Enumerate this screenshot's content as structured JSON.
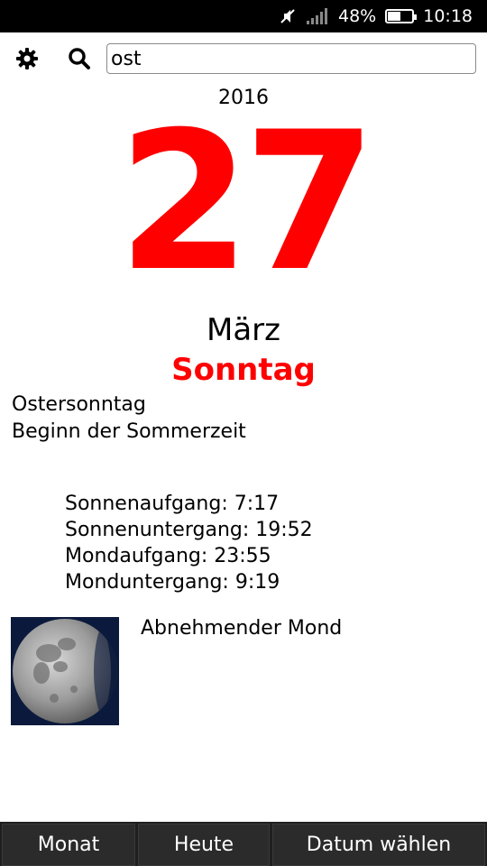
{
  "status_bar": {
    "battery_percent": "48%",
    "battery_level": 0.48,
    "time": "10:18",
    "icons": [
      "mute-icon",
      "signal-icon",
      "battery-icon"
    ]
  },
  "toolbar": {
    "settings_icon": "gear-icon",
    "search_icon": "search-icon",
    "search_value": "ost"
  },
  "date": {
    "year": "2016",
    "day": "27",
    "month": "März",
    "weekday": "Sonntag"
  },
  "holidays": [
    "Ostersonntag",
    "Beginn der Sommerzeit"
  ],
  "sun_moon": [
    "Sonnenaufgang: 7:17",
    "Sonnenuntergang: 19:52",
    "Mondaufgang: 23:55",
    "Monduntergang: 9:19"
  ],
  "moon": {
    "phase": "Abnehmender Mond",
    "image_icon": "moon-phase-icon"
  },
  "bottom_nav": {
    "month": "Monat",
    "today": "Heute",
    "choose_date": "Datum wählen"
  },
  "colors": {
    "accent": "#ff0000",
    "status_bar_bg": "#000000",
    "bottom_bar_bg": "#1f1f1f"
  }
}
